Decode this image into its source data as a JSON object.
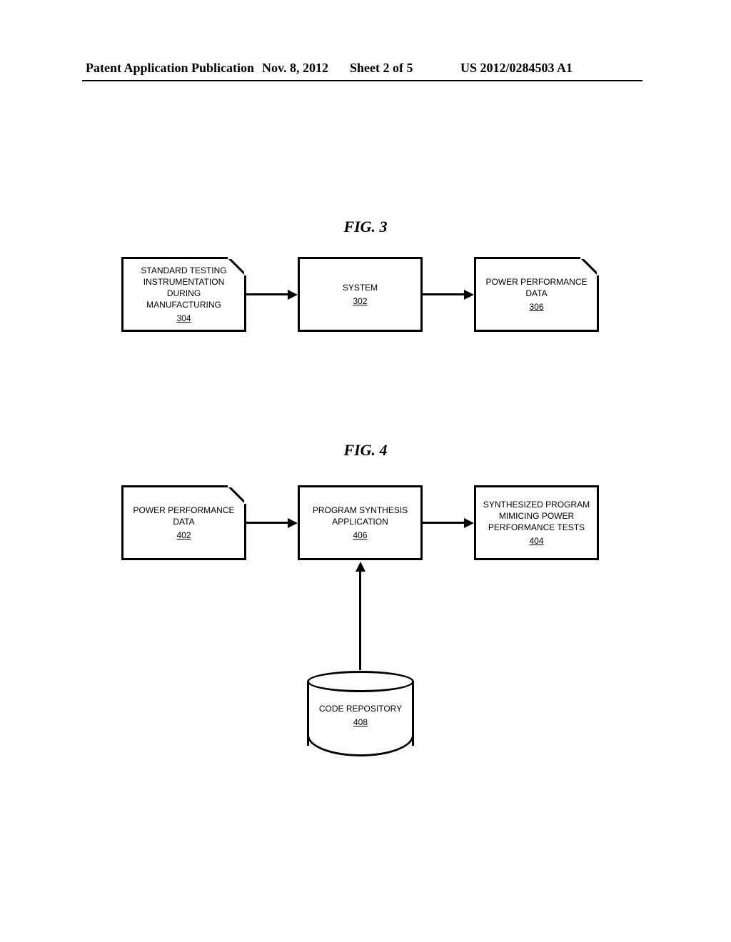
{
  "header": {
    "publication": "Patent Application Publication",
    "date": "Nov. 8, 2012",
    "sheet": "Sheet 2 of 5",
    "number": "US 2012/0284503 A1"
  },
  "fig3": {
    "label": "FIG. 3",
    "box1": {
      "text": "STANDARD TESTING INSTRUMENTATION DURING MANUFACTURING",
      "ref": "304"
    },
    "box2": {
      "text": "SYSTEM",
      "ref": "302"
    },
    "box3": {
      "text": "POWER PERFORMANCE DATA",
      "ref": "306"
    }
  },
  "fig4": {
    "label": "FIG. 4",
    "box1": {
      "text": "POWER PERFORMANCE DATA",
      "ref": "402"
    },
    "box2": {
      "text": "PROGRAM SYNTHESIS APPLICATION",
      "ref": "406"
    },
    "box3": {
      "text": "SYNTHESIZED PROGRAM MIMICING POWER PERFORMANCE TESTS",
      "ref": "404"
    },
    "cylinder": {
      "text": "CODE REPOSITORY",
      "ref": "408"
    }
  }
}
